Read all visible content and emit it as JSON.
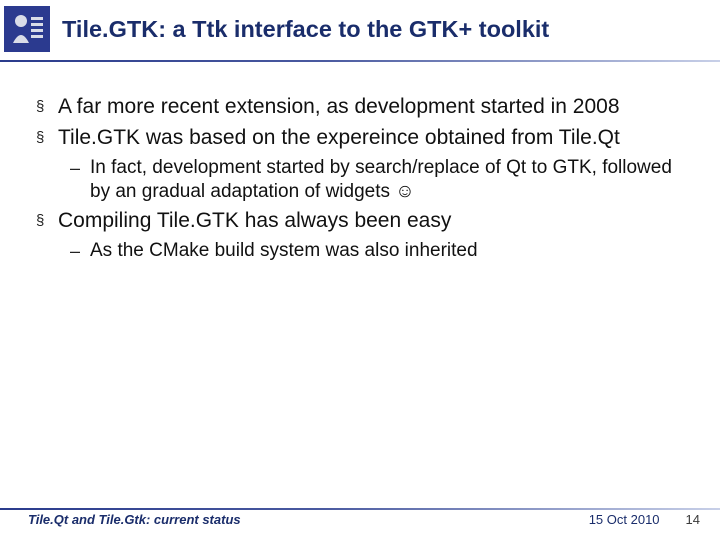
{
  "header": {
    "title": "Tile.GTK: a Ttk interface to the GTK+ toolkit"
  },
  "bullets": {
    "b1": "A far more recent extension, as development started in 2008",
    "b2": "Tile.GTK was based on the expereince obtained from Tile.Qt",
    "b2a": "In fact, development started by search/replace of Qt to GTK, followed by an gradual adaptation of widgets ☺",
    "b3": "Compiling Tile.GTK has always been easy",
    "b3a": "As the CMake build system was also inherited"
  },
  "footer": {
    "left": "Tile.Qt and Tile.Gtk: current status",
    "date": "15 Oct 2010",
    "page": "14"
  }
}
